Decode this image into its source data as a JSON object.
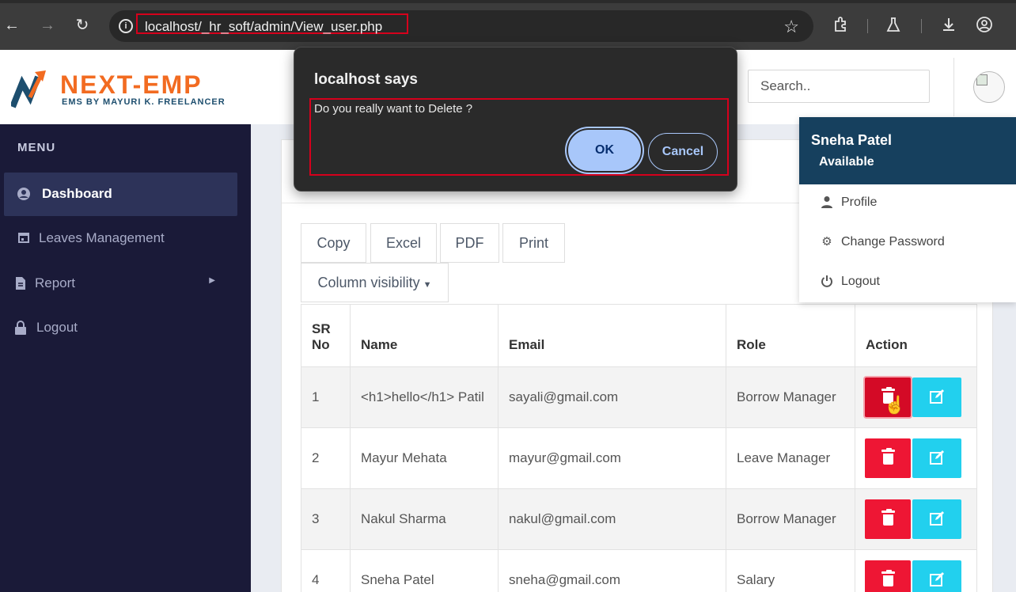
{
  "browser": {
    "url": "localhost/_hr_soft/admin/View_user.php",
    "icons": [
      "back-icon",
      "forward-icon",
      "reload-icon",
      "site-info-icon",
      "bookmark-star-icon",
      "extensions-icon",
      "labs-icon",
      "download-icon",
      "profile-icon"
    ]
  },
  "brand": {
    "title": "NEXT-EMP",
    "subtitle": "EMS BY MAYURI K. FREELANCER",
    "accent": "#f26b21",
    "secondary": "#1d4e6e"
  },
  "header": {
    "search_placeholder": "Search.."
  },
  "sidebar": {
    "heading": "MENU",
    "items": [
      {
        "label": "Dashboard",
        "icon": "user-circle-icon",
        "active": true
      },
      {
        "label": "Leaves Management",
        "icon": "calendar-icon"
      },
      {
        "label": "Report",
        "icon": "file-icon",
        "has_submenu": true
      },
      {
        "label": "Logout",
        "icon": "lock-icon"
      }
    ]
  },
  "toolbar": {
    "copy": "Copy",
    "excel": "Excel",
    "pdf": "PDF",
    "print": "Print",
    "column_visibility": "Column visibility"
  },
  "table": {
    "headers": {
      "sr1": "SR",
      "sr2": "No",
      "name": "Name",
      "email": "Email",
      "role": "Role",
      "action": "Action"
    },
    "rows": [
      {
        "sr": "1",
        "name": "<h1>hello</h1> Patil",
        "email": "sayali@gmail.com",
        "role": "Borrow Manager"
      },
      {
        "sr": "2",
        "name": "Mayur Mehata",
        "email": "mayur@gmail.com",
        "role": "Leave Manager"
      },
      {
        "sr": "3",
        "name": "Nakul Sharma",
        "email": "nakul@gmail.com",
        "role": "Borrow Manager"
      },
      {
        "sr": "4",
        "name": "Sneha Patel",
        "email": "sneha@gmail.com",
        "role": "Salary"
      }
    ]
  },
  "user_menu": {
    "name": "Sneha Patel",
    "status": "Available",
    "items": [
      {
        "label": "Profile",
        "icon": "user-icon"
      },
      {
        "label": "Change Password",
        "icon": "gear-icon"
      },
      {
        "label": "Logout",
        "icon": "power-icon"
      }
    ]
  },
  "dialog": {
    "title": "localhost says",
    "message": "Do you really want to Delete ?",
    "ok": "OK",
    "cancel": "Cancel"
  },
  "colors": {
    "sidebar_bg": "#1a1a38",
    "delete": "#ee1634",
    "edit": "#22d0ee",
    "user_menu_header": "#16405e"
  }
}
